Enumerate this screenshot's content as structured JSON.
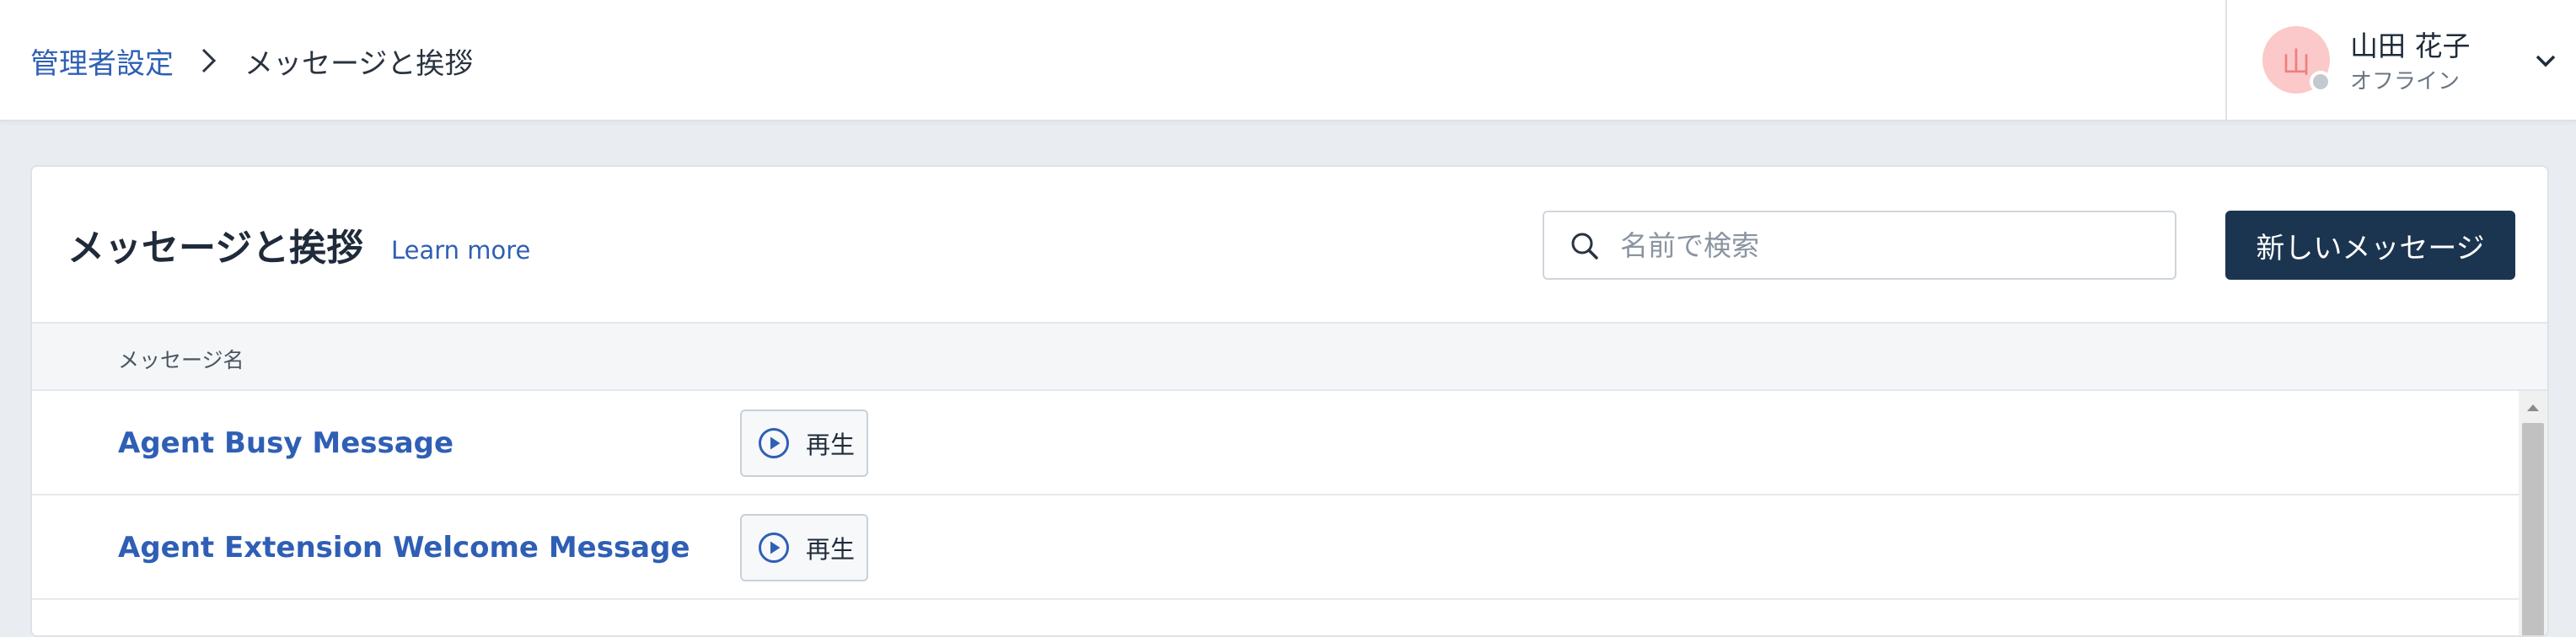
{
  "breadcrumb": {
    "parent": "管理者設定",
    "current": "メッセージと挨拶"
  },
  "user": {
    "avatar_initial": "山",
    "name": "山田 花子",
    "status": "オフライン"
  },
  "page": {
    "title": "メッセージと挨拶",
    "learn_more": "Learn more",
    "search_placeholder": "名前で検索",
    "new_button": "新しいメッセージ"
  },
  "table": {
    "column_name": "メッセージ名",
    "rows": [
      {
        "name": "Agent Busy Message",
        "play_label": "再生"
      },
      {
        "name": "Agent Extension Welcome Message",
        "play_label": "再生"
      }
    ]
  },
  "colors": {
    "link": "#2f5fb5",
    "primary_button": "#1b3550",
    "avatar_bg": "#fbc9c9",
    "status_offline": "#c4c9cf"
  },
  "icons": {
    "breadcrumb_separator": "chevron-right-icon",
    "user_menu": "chevron-down-icon",
    "search": "search-icon",
    "play": "play-circle-icon",
    "scroll_up": "scroll-up-arrow-icon"
  }
}
